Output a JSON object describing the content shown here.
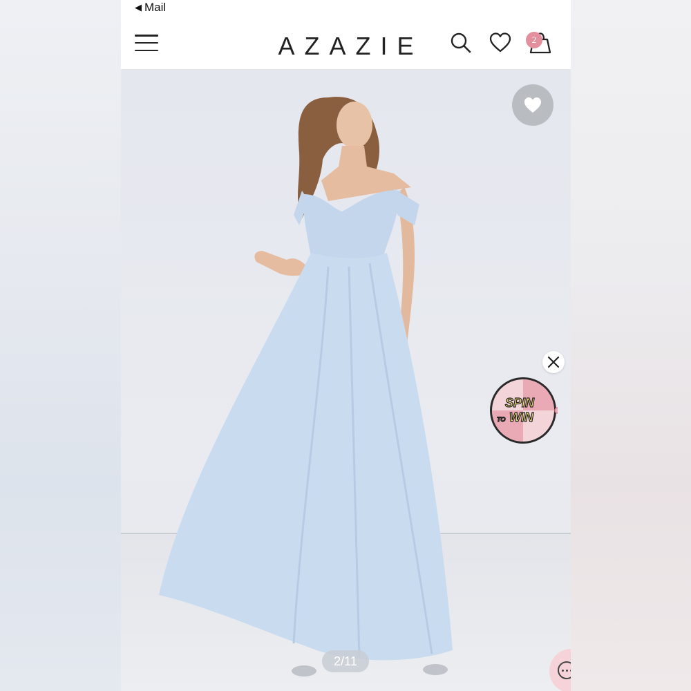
{
  "status_bar": {
    "back_label": "Mail"
  },
  "header": {
    "logo": "AZAZIE",
    "cart_count": "2"
  },
  "gallery": {
    "counter": "2/11"
  },
  "promo": {
    "line1": "SPIN",
    "line2_small": "TO",
    "line2": "WIN"
  },
  "colors": {
    "accent": "#e48f9e",
    "dress": "#c9dbef",
    "fav_bg": "#b9bcc0"
  },
  "icons": [
    "menu-icon",
    "search-icon",
    "heart-icon",
    "bag-icon",
    "favorite-heart-icon",
    "close-icon",
    "chat-icon"
  ]
}
